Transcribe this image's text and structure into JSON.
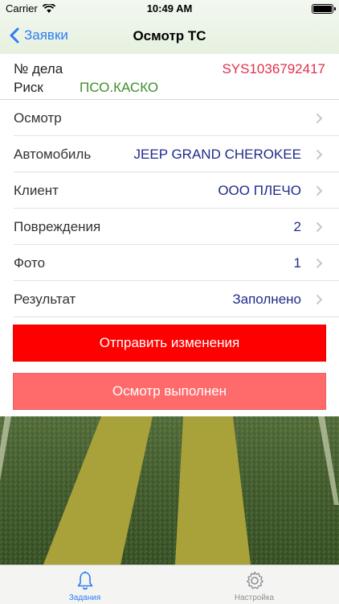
{
  "status_bar": {
    "carrier": "Carrier",
    "time": "10:49 AM"
  },
  "nav": {
    "back_label": "Заявки",
    "title": "Осмотр ТС"
  },
  "case": {
    "number_label": "№ дела",
    "number_value": "SYS1036792417",
    "risk_label": "Риск",
    "risk_value": "ПСО.КАСКО"
  },
  "rows": [
    {
      "label": "Осмотр",
      "value": ""
    },
    {
      "label": "Автомобиль",
      "value": "JEEP GRAND CHEROKEE"
    },
    {
      "label": "Клиент",
      "value": "ООО ПЛЕЧО"
    },
    {
      "label": "Повреждения",
      "value": "2"
    },
    {
      "label": "Фото",
      "value": "1"
    },
    {
      "label": "Результат",
      "value": "Заполнено"
    }
  ],
  "buttons": {
    "send": "Отправить изменения",
    "done": "Осмотр выполнен"
  },
  "tabs": [
    {
      "label": "Задания",
      "icon": "bell-icon",
      "active": true
    },
    {
      "label": "Настройка",
      "icon": "gear-icon",
      "active": false
    }
  ],
  "colors": {
    "accent": "#2d7cf6",
    "case_number": "#e0304c",
    "risk": "#3e8f2e",
    "row_value": "#1f2a8a",
    "send_button": "#ff0000",
    "done_button": "#ff6b6b"
  }
}
